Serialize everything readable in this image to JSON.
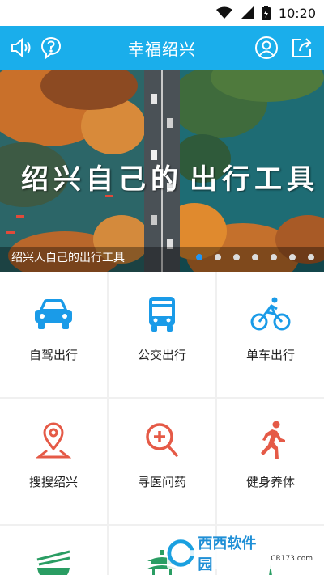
{
  "status_bar": {
    "time": "10:20",
    "icons": [
      "wifi-icon",
      "signal-icon",
      "battery-charging-icon"
    ]
  },
  "app_bar": {
    "title": "幸福绍兴",
    "left_icons": [
      "volume-icon",
      "help-chat-icon"
    ],
    "right_icons": [
      "user-icon",
      "share-icon"
    ]
  },
  "banner": {
    "headline_left": "绍兴自己的",
    "headline_right": "出行工具",
    "caption": "绍兴人自己的出行工具",
    "slide_count": 7,
    "active_slide": 1
  },
  "grid": {
    "items": [
      {
        "label": "自驾出行",
        "icon": "car-icon",
        "color": "#1a9be8"
      },
      {
        "label": "公交出行",
        "icon": "bus-icon",
        "color": "#1a9be8"
      },
      {
        "label": "单车出行",
        "icon": "bicycle-icon",
        "color": "#1a9be8"
      },
      {
        "label": "搜搜绍兴",
        "icon": "map-pin-icon",
        "color": "#e55a47"
      },
      {
        "label": "寻医问药",
        "icon": "medical-search-icon",
        "color": "#e55a47"
      },
      {
        "label": "健身养体",
        "icon": "runner-icon",
        "color": "#e55a47"
      },
      {
        "label": "",
        "icon": "food-bowl-icon",
        "color": "#2a9d63"
      },
      {
        "label": "",
        "icon": "pavilion-icon",
        "color": "#2a9d63"
      },
      {
        "label": "",
        "icon": "boat-icon",
        "color": "#2a9d63"
      }
    ]
  },
  "watermark": {
    "text": "西西软件园",
    "sub": "CR173.com"
  }
}
